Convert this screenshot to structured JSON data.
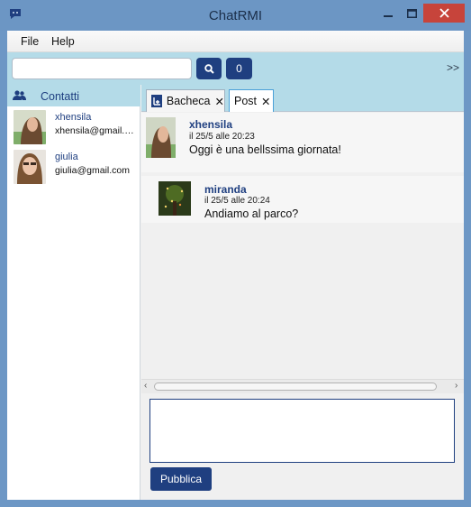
{
  "window": {
    "title": "ChatRMI",
    "accent": "#6c96c4",
    "close_color": "#c7443b",
    "icons": {
      "app": "chat-bubble-icon",
      "min": "minimize-icon",
      "max": "maximize-icon",
      "close": "close-icon"
    }
  },
  "menu": {
    "items": [
      "File",
      "Help"
    ]
  },
  "toolbar": {
    "search_value": "",
    "search_icon": "search-icon",
    "count_label": "0",
    "expand_label": ">>",
    "button_color": "#1f3f80",
    "band_color": "#b4dbe8"
  },
  "contacts": {
    "header": "Contatti",
    "header_icon": "users-icon",
    "items": [
      {
        "name": "xhensila",
        "email": "xhensila@gmail.com"
      },
      {
        "name": "giulia",
        "email": "giulia@gmail.com"
      }
    ]
  },
  "tabs": [
    {
      "label": "Bacheca",
      "icon": "board-icon",
      "close": "✕"
    },
    {
      "label": "Post",
      "close": "✕"
    }
  ],
  "posts": [
    {
      "author": "xhensila",
      "date": "il 25/5 alle 20:23",
      "text": "Oggi è una bellssima giornata!"
    },
    {
      "author": "miranda",
      "date": "il 25/5 alle 20:24",
      "text": "Andiamo al parco?"
    }
  ],
  "composer": {
    "value": "",
    "publish_label": "Pubblica"
  }
}
